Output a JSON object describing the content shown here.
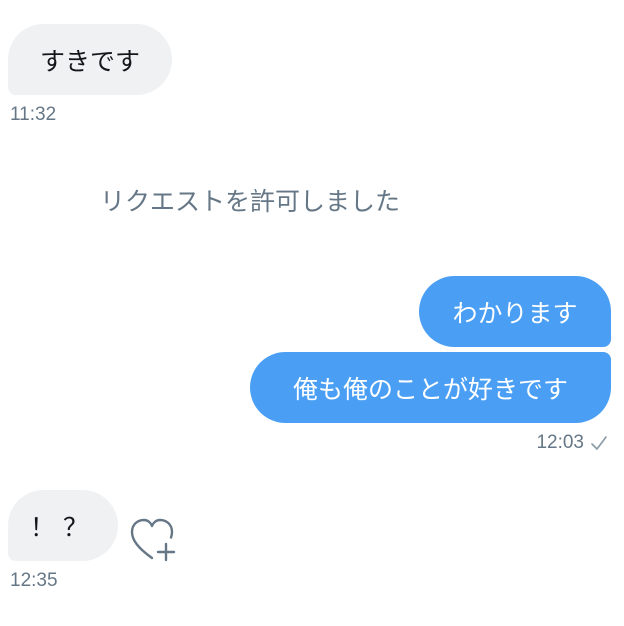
{
  "messages": [
    {
      "id": "msg1",
      "direction": "incoming",
      "text": "すきです"
    },
    {
      "id": "msg2",
      "direction": "outgoing",
      "text": "わかります"
    },
    {
      "id": "msg3",
      "direction": "outgoing",
      "text": "俺も俺のことが好きです"
    },
    {
      "id": "msg4",
      "direction": "incoming",
      "text": "！？"
    }
  ],
  "timestamps": {
    "t1": "11:32",
    "t2": "12:03",
    "t3": "12:35"
  },
  "system_notice": "リクエストを許可しました",
  "icons": {
    "read_receipt": "checkmark-icon",
    "reaction": "heart-plus-icon"
  },
  "colors": {
    "incoming_bubble": "#eff1f3",
    "outgoing_bubble": "#4a9ff5",
    "muted_text": "#657786"
  }
}
